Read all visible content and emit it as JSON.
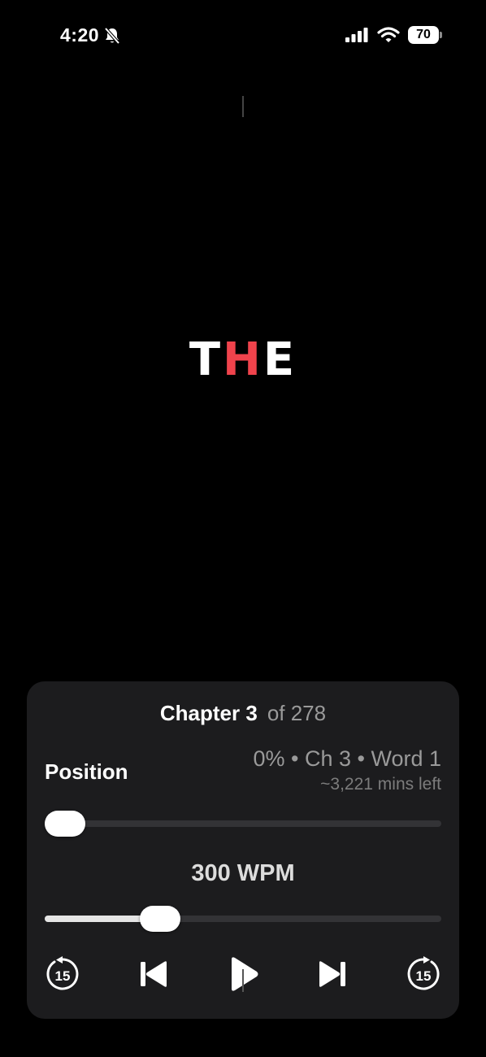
{
  "status_bar": {
    "time": "4:20",
    "battery": "70"
  },
  "reader": {
    "word_before": "T",
    "word_focus": "H",
    "word_after": "E",
    "focus_color": "#f0434c"
  },
  "panel": {
    "chapter_title": "Chapter 3",
    "chapter_of": "of 278",
    "position_label": "Position",
    "position_detail": "0% • Ch 3 • Word 1",
    "position_remaining": "~3,221 mins left",
    "position_progress": 0.0,
    "wpm_label": "300 WPM",
    "speed_fraction": 0.29,
    "controls": {
      "rewind": {
        "icon": "rewind-15-icon",
        "label": "15"
      },
      "previous": {
        "icon": "skip-previous-icon"
      },
      "play": {
        "icon": "play-icon"
      },
      "next": {
        "icon": "skip-next-icon"
      },
      "forward": {
        "icon": "forward-15-icon",
        "label": "15"
      }
    }
  }
}
